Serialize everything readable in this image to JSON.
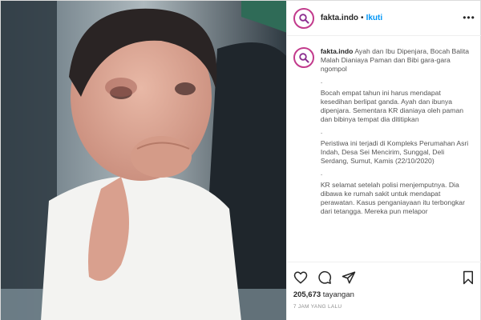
{
  "account": {
    "username": "fakta.indo",
    "follow_label": "Ikuti",
    "separator": "•"
  },
  "caption": {
    "username": "fakta.indo",
    "paragraphs": [
      "Ayah dan Ibu Dipenjara, Bocah Balita Malah Dianiaya Paman dan Bibi gara-gara ngompol",
      ".",
      "Bocah empat tahun ini harus mendapat kesedihan berlipat ganda. Ayah dan ibunya dipenjara. Sementara KR dianiaya oleh paman dan bibinya tempat dia dititipkan",
      ".",
      "Peristiwa ini terjadi di Kompleks Perumahan Asri Indah, Desa Sei Mencirim, Sunggal, Deli Serdang, Sumut, Kamis (22/10/2020)",
      ".",
      "KR selamat setelah polisi menjemputnya. Dia dibawa ke rumah sakit untuk mendapat perawatan. Kasus penganiayaan itu terbongkar dari tetangga. Mereka pun melapor"
    ]
  },
  "stats": {
    "views_count": "205,673",
    "views_label": "tayangan",
    "posted": "7 JAM YANG LALU"
  },
  "icons": {
    "avatar": "magnifier-logo-icon",
    "more": "more-options-icon",
    "like": "heart-icon",
    "comment": "comment-icon",
    "share": "share-icon",
    "save": "bookmark-icon"
  },
  "colors": {
    "follow": "#0095f6",
    "avatar_ring": "#c23a8c",
    "logo": "#8b2d8f"
  }
}
